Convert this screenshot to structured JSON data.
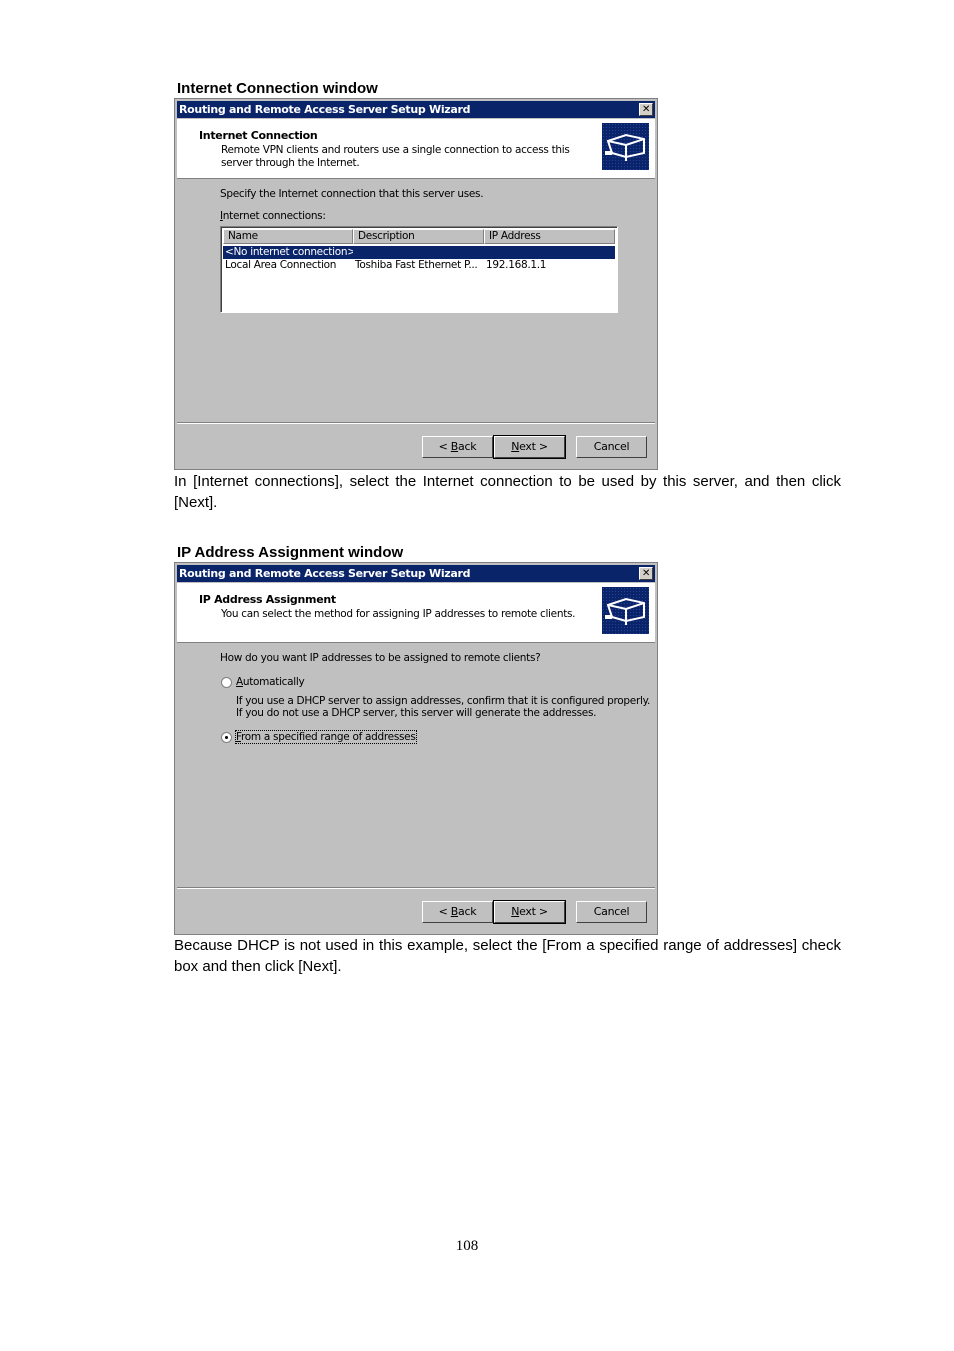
{
  "section1": {
    "caption": "Internet Connection window",
    "dialog": {
      "title": "Routing and Remote Access Server Setup Wizard",
      "close_glyph": "✕",
      "header_title": "Internet Connection",
      "header_subtitle": "Remote VPN clients and routers use a single connection to access this server through the Internet.",
      "icon": "network-wizard-icon",
      "instruction": "Specify the Internet connection that this server uses.",
      "list_label_mnemonic": "I",
      "list_label_rest": "nternet connections:",
      "columns": [
        "Name",
        "Description",
        "IP Address"
      ],
      "rows": [
        {
          "name": "<No internet connection>",
          "description": "",
          "ip": "",
          "selected": true
        },
        {
          "name": "Local Area Connection",
          "description": "Toshiba Fast Ethernet P...",
          "ip": "192.168.1.1",
          "selected": false
        }
      ],
      "buttons": {
        "back_prefix": "< ",
        "back_mnemonic": "B",
        "back_rest": "ack",
        "next_mnemonic": "N",
        "next_rest": "ext >",
        "cancel": "Cancel"
      }
    },
    "description": "In [Internet connections], select the Internet connection to be used by this server, and then click [Next]."
  },
  "section2": {
    "caption": "IP Address Assignment window",
    "dialog": {
      "title": "Routing and Remote Access Server Setup Wizard",
      "close_glyph": "✕",
      "header_title": "IP Address Assignment",
      "header_subtitle": "You can select the method for assigning IP addresses to remote clients.",
      "icon": "network-wizard-icon",
      "question": "How do you want IP addresses to be assigned to remote clients?",
      "option_auto_mnemonic": "A",
      "option_auto_rest": "utomatically",
      "option_auto_selected": false,
      "auto_help_line1": "If you use a DHCP server to assign addresses, confirm that it is configured properly.",
      "auto_help_line2": "If you do not use a DHCP server, this server will generate the addresses.",
      "option_range_mnemonic": "F",
      "option_range_rest": "rom a specified range of addresses",
      "option_range_selected": true,
      "buttons": {
        "back_prefix": "< ",
        "back_mnemonic": "B",
        "back_rest": "ack",
        "next_mnemonic": "N",
        "next_rest": "ext >",
        "cancel": "Cancel"
      }
    },
    "description": "Because DHCP is not used in this example, select the [From a specified range of addresses] check box and then click [Next]."
  },
  "page_number": "108"
}
